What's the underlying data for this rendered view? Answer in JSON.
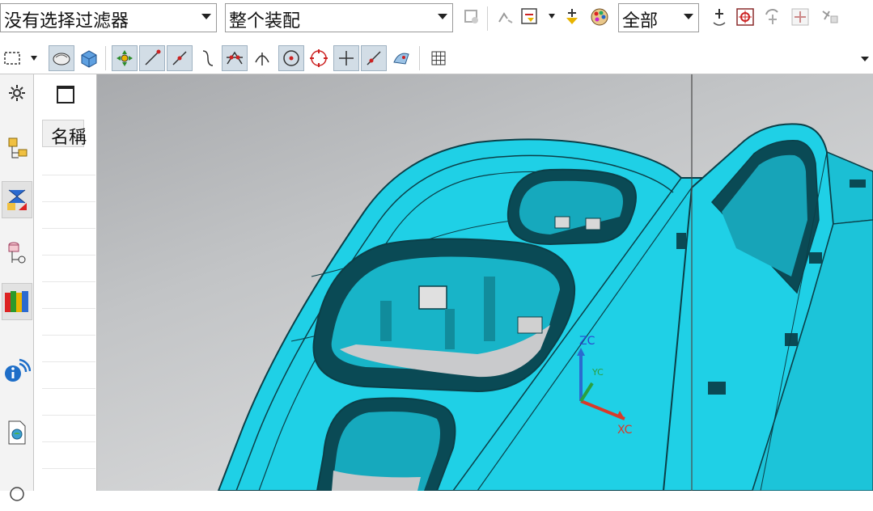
{
  "filter_bar": {
    "type_filter": "没有选择过滤器",
    "scope": "整个装配",
    "layer": "全部"
  },
  "navigator": {
    "column_name": "名稱"
  },
  "viewport": {
    "axis_z": "ZC",
    "axis_x": "XC",
    "axis_y": "YC"
  },
  "colors": {
    "part_cyan": "#1fd0e6",
    "part_edge": "#0b3f48",
    "viewport_bg": "#c4c5c7"
  }
}
